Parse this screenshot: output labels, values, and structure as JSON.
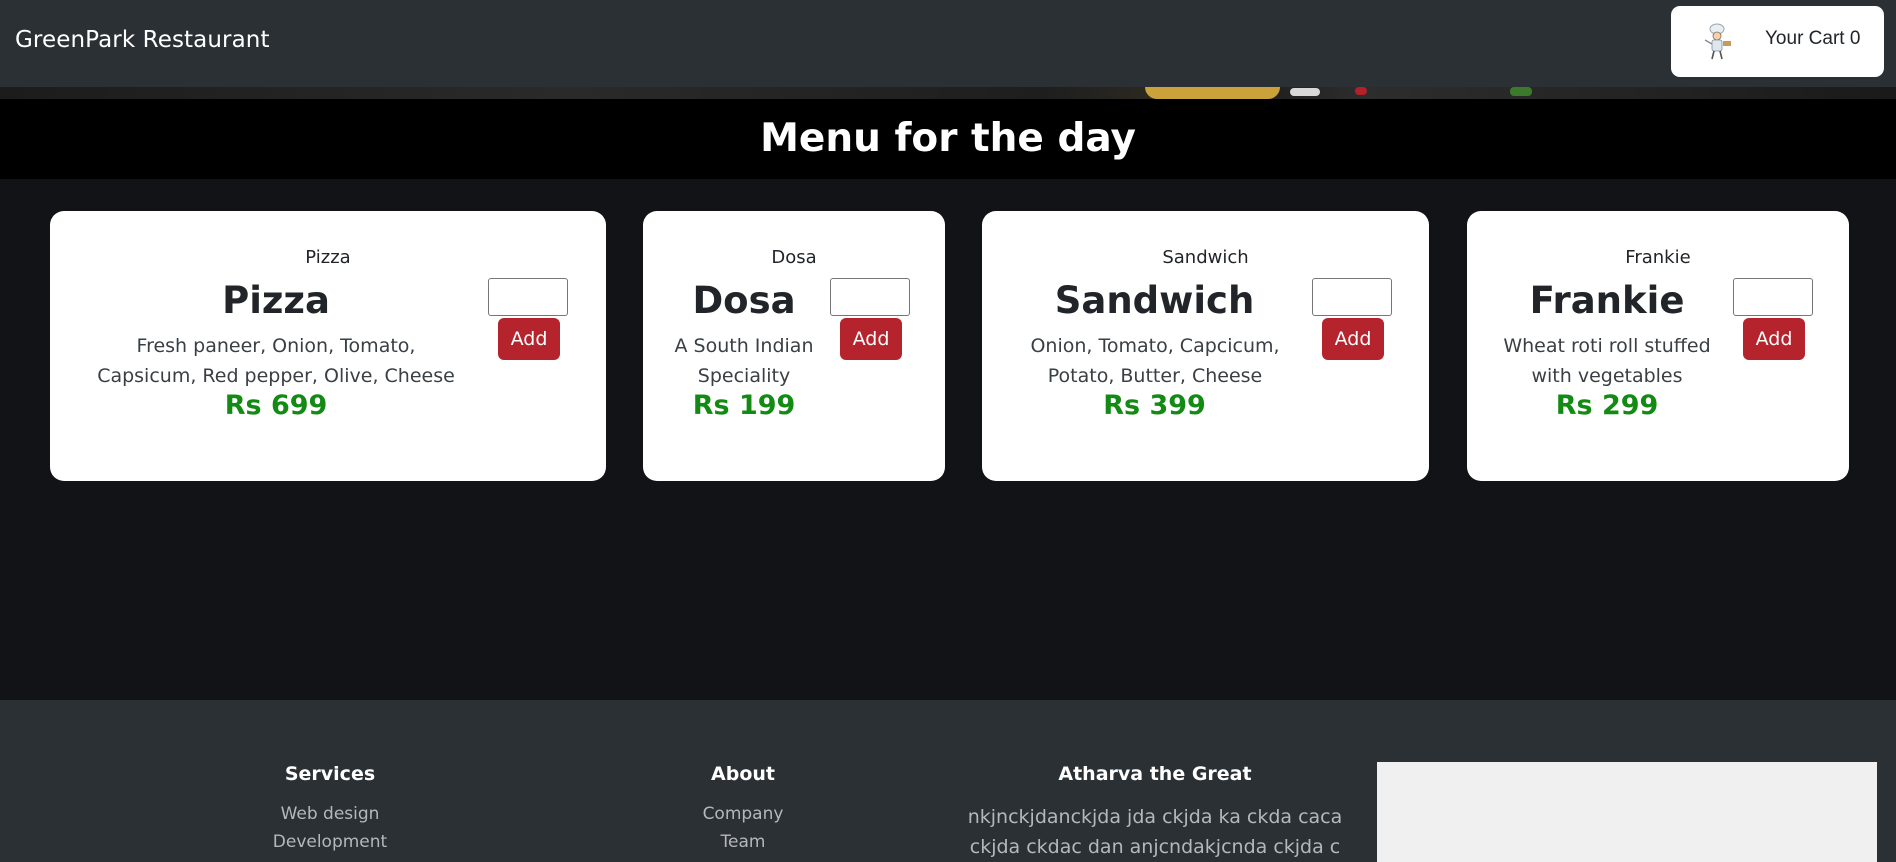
{
  "navbar": {
    "brand": "GreenPark Restaurant",
    "cart_label": "Your Cart 0"
  },
  "menu": {
    "title": "Menu for the day",
    "items": [
      {
        "category": "Pizza",
        "name": "Pizza",
        "description": "Fresh paneer, Onion, Tomato, Capsicum, Red pepper, Olive, Cheese",
        "price": "Rs 699",
        "add_label": "Add",
        "quantity": ""
      },
      {
        "category": "Dosa",
        "name": "Dosa",
        "description": "A South Indian Speciality",
        "price": "Rs 199",
        "add_label": "Add",
        "quantity": ""
      },
      {
        "category": "Sandwich",
        "name": "Sandwich",
        "description": "Onion, Tomato, Capcicum, Potato, Butter, Cheese",
        "price": "Rs 399",
        "add_label": "Add",
        "quantity": ""
      },
      {
        "category": "Frankie",
        "name": "Frankie",
        "description": "Wheat roti roll stuffed with vegetables",
        "price": "Rs 299",
        "add_label": "Add",
        "quantity": ""
      }
    ]
  },
  "footer": {
    "services": {
      "title": "Services",
      "links": [
        "Web design",
        "Development"
      ]
    },
    "about": {
      "title": "About",
      "links": [
        "Company",
        "Team"
      ]
    },
    "company": {
      "title": "Atharva the Great",
      "text": "nkjnckjdanckjda jda ckjda ka ckda caca ckjda ckdac dan anjcndakjcnda ckjda c akj"
    }
  },
  "colors": {
    "navbar_bg": "#2b3035",
    "page_bg": "#121316",
    "add_button": "#b5242c",
    "price": "#138a13"
  },
  "icons": {
    "cart": "chef-cart-icon"
  }
}
